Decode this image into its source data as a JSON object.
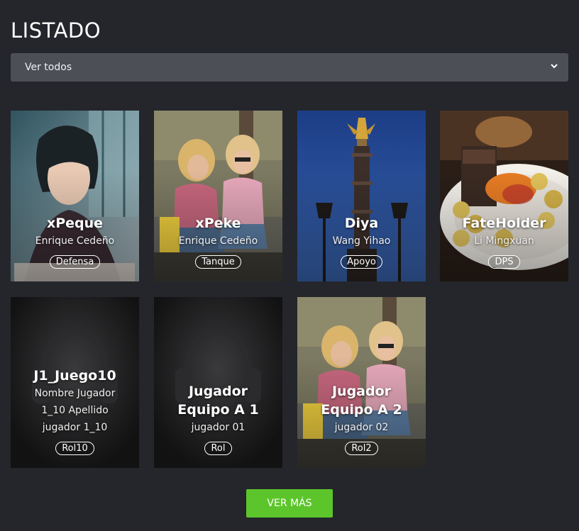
{
  "page": {
    "title": "LISTADO"
  },
  "filter": {
    "selected": "Ver todos"
  },
  "players": [
    {
      "nick": "xPeque",
      "name": "Enrique Cedeño",
      "role": "Defensa",
      "image": "photo-woman-window"
    },
    {
      "nick": "xPeke",
      "name": "Enrique Cedeño",
      "role": "Tanque",
      "image": "photo-two-girls-phones"
    },
    {
      "nick": "Diya",
      "name": "Wang Yihao",
      "role": "Apoyo",
      "image": "photo-victory-column"
    },
    {
      "nick": "FateHolder",
      "name": "Li Mingxuan",
      "role": "DPS",
      "image": "photo-food-plate"
    },
    {
      "nick": "J1_Juego10",
      "name_lines": [
        "Nombre Jugador",
        "1_10 Apellido",
        "jugador 1_10"
      ],
      "role": "Rol10",
      "image": "headset-placeholder"
    },
    {
      "nick_lines": [
        "Jugador",
        "Equipo A 1"
      ],
      "name": "jugador 01",
      "role": "Rol",
      "image": "headset-placeholder"
    },
    {
      "nick_lines": [
        "Jugador",
        "Equipo A 2"
      ],
      "name": "jugador 02",
      "role": "Rol2",
      "image": "photo-two-girls-phones"
    }
  ],
  "actions": {
    "more_label": "VER MÁS"
  },
  "colors": {
    "background": "#24262c",
    "select": "#4d4f57",
    "more_button": "#5cc52b"
  }
}
